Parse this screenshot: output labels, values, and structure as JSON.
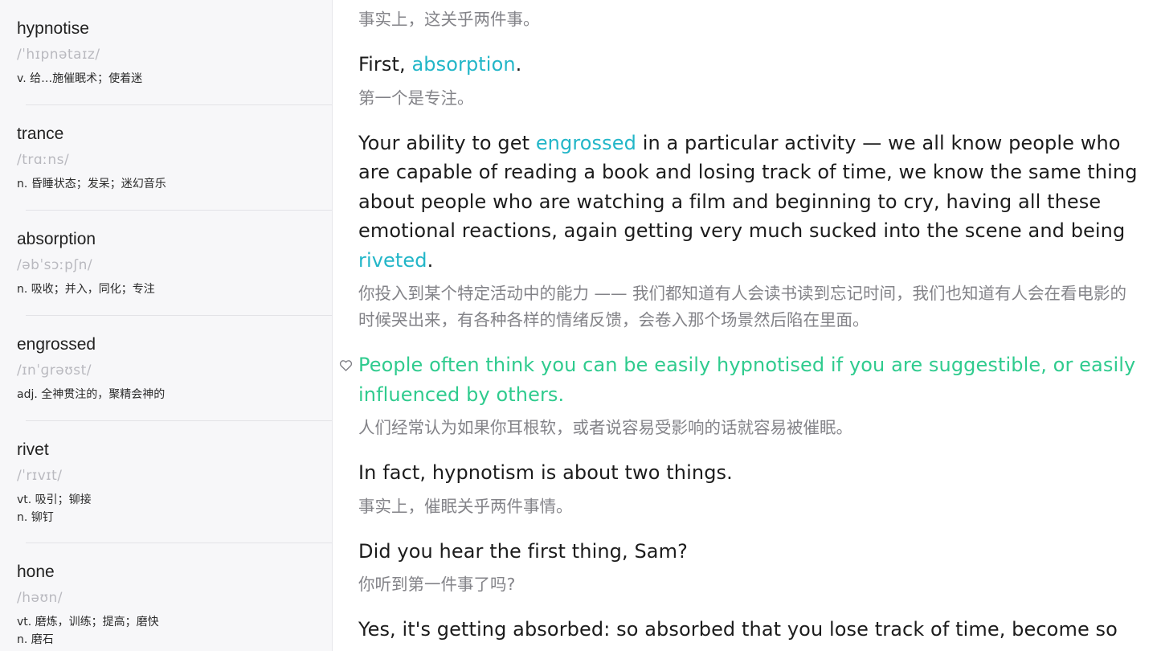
{
  "sidebar": {
    "items": [
      {
        "word": "hypnotise",
        "phonetic": "/ˈhɪpnətaɪz/",
        "definitions": [
          "v. 给…施催眠术；使着迷"
        ]
      },
      {
        "word": "trance",
        "phonetic": "/trɑːns/",
        "definitions": [
          "n. 昏睡状态；发呆；迷幻音乐"
        ]
      },
      {
        "word": "absorption",
        "phonetic": "/əbˈsɔːpʃn/",
        "definitions": [
          "n. 吸收；并入，同化；专注"
        ]
      },
      {
        "word": "engrossed",
        "phonetic": "/ɪnˈɡrəʊst/",
        "definitions": [
          "adj. 全神贯注的，聚精会神的"
        ]
      },
      {
        "word": "rivet",
        "phonetic": "/ˈrɪvɪt/",
        "definitions": [
          "vt. 吸引；铆接",
          "n. 铆钉"
        ]
      },
      {
        "word": "hone",
        "phonetic": "/həʊn/",
        "definitions": [
          "vt. 磨炼，训练；提高；磨快",
          "n. 磨石"
        ]
      }
    ]
  },
  "transcript": {
    "s0": {
      "zh": "事实上，这关乎两件事。"
    },
    "s1": {
      "en_pre": "First, ",
      "en_hl": "absorption",
      "en_post": ".",
      "zh": "第一个是专注。"
    },
    "s2": {
      "en_a": "Your ability to get ",
      "en_hl1": "engrossed",
      "en_b": " in a particular activity — we all know people who are capable of reading a book and losing track of time, we know the same thing about people who are watching a film and beginning to cry, having all these emotional reactions, again getting very much sucked into the scene and being ",
      "en_hl2": "riveted",
      "en_c": ".",
      "zh": "你投入到某个特定活动中的能力 —— 我们都知道有人会读书读到忘记时间，我们也知道有人会在看电影的时候哭出来，有各种各样的情绪反馈，会卷入那个场景然后陷在里面。"
    },
    "s3": {
      "en": "People often think you can be easily hypnotised if you are suggestible, or easily influenced by others.",
      "zh": "人们经常认为如果你耳根软，或者说容易受影响的话就容易被催眠。",
      "favorite_icon": "heart-outline-icon"
    },
    "s4": {
      "en": "In fact, hypnotism is about two things.",
      "zh": "事实上，催眠关乎两件事情。"
    },
    "s5": {
      "en": "Did you hear the first thing, Sam?",
      "zh": "你听到第一件事了吗?"
    },
    "s6": {
      "en": "Yes, it's getting absorbed: so absorbed that you lose track of time, become so"
    }
  },
  "colors": {
    "highlight_word": "#22b6c8",
    "favorite_sentence": "#2fcb8e",
    "translation": "#838388",
    "sidebar_bg": "#f7f7f9"
  }
}
